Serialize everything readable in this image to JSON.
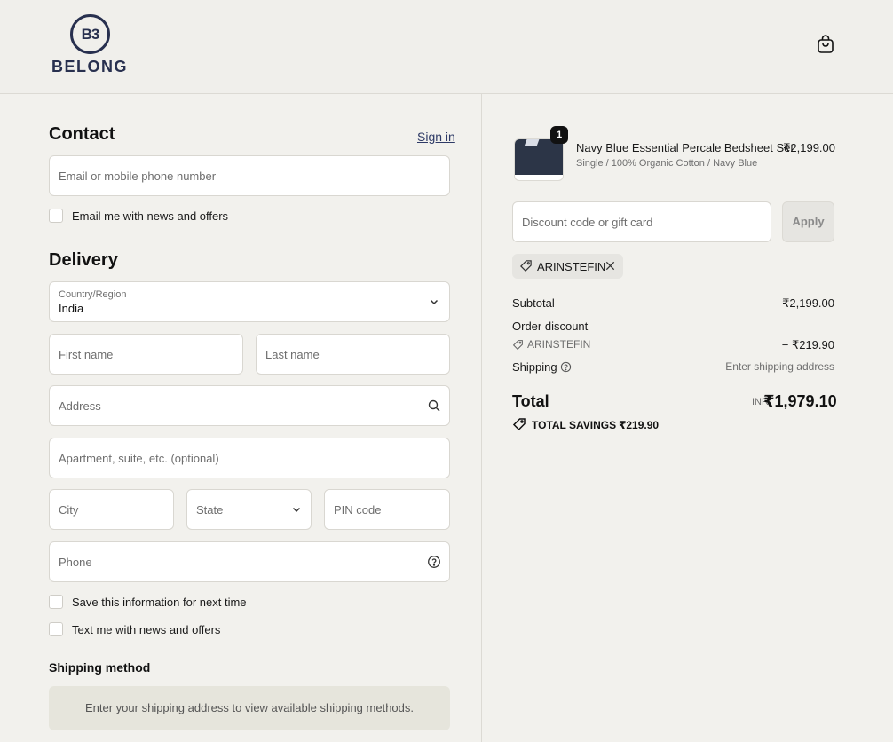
{
  "brand": {
    "name": "BELONG",
    "mark": "B"
  },
  "header": {
    "cart_icon": "shopping-bag-icon"
  },
  "contact": {
    "heading": "Contact",
    "sign_in": "Sign in",
    "email_placeholder": "Email or mobile phone number",
    "newsletter_label": "Email me with news and offers"
  },
  "delivery": {
    "heading": "Delivery",
    "country_label": "Country/Region",
    "country_value": "India",
    "first_name_placeholder": "First name",
    "last_name_placeholder": "Last name",
    "address_placeholder": "Address",
    "apartment_placeholder": "Apartment, suite, etc. (optional)",
    "city_placeholder": "City",
    "state_placeholder": "State",
    "pin_placeholder": "PIN code",
    "phone_placeholder": "Phone",
    "save_info_label": "Save this information for next time",
    "text_me_label": "Text me with news and offers"
  },
  "shipping_method": {
    "heading": "Shipping method",
    "message": "Enter your shipping address to view available shipping methods."
  },
  "summary": {
    "item": {
      "quantity": "1",
      "name": "Navy Blue Essential Percale Bedsheet Set",
      "variant": "Single / 100% Organic Cotton / Navy Blue",
      "price": "₹2,199.00"
    },
    "discount_placeholder": "Discount code or gift card",
    "apply_label": "Apply",
    "applied_code": "ARINSTEFIN",
    "subtotal_label": "Subtotal",
    "subtotal_value": "₹2,199.00",
    "order_discount_label": "Order discount",
    "discount_code": "ARINSTEFIN",
    "discount_value": "− ₹219.90",
    "shipping_label": "Shipping",
    "shipping_value": "Enter shipping address",
    "total_label": "Total",
    "currency": "INR",
    "total_value": "₹1,979.10",
    "savings_label": "TOTAL SAVINGS",
    "savings_value": "₹219.90"
  }
}
